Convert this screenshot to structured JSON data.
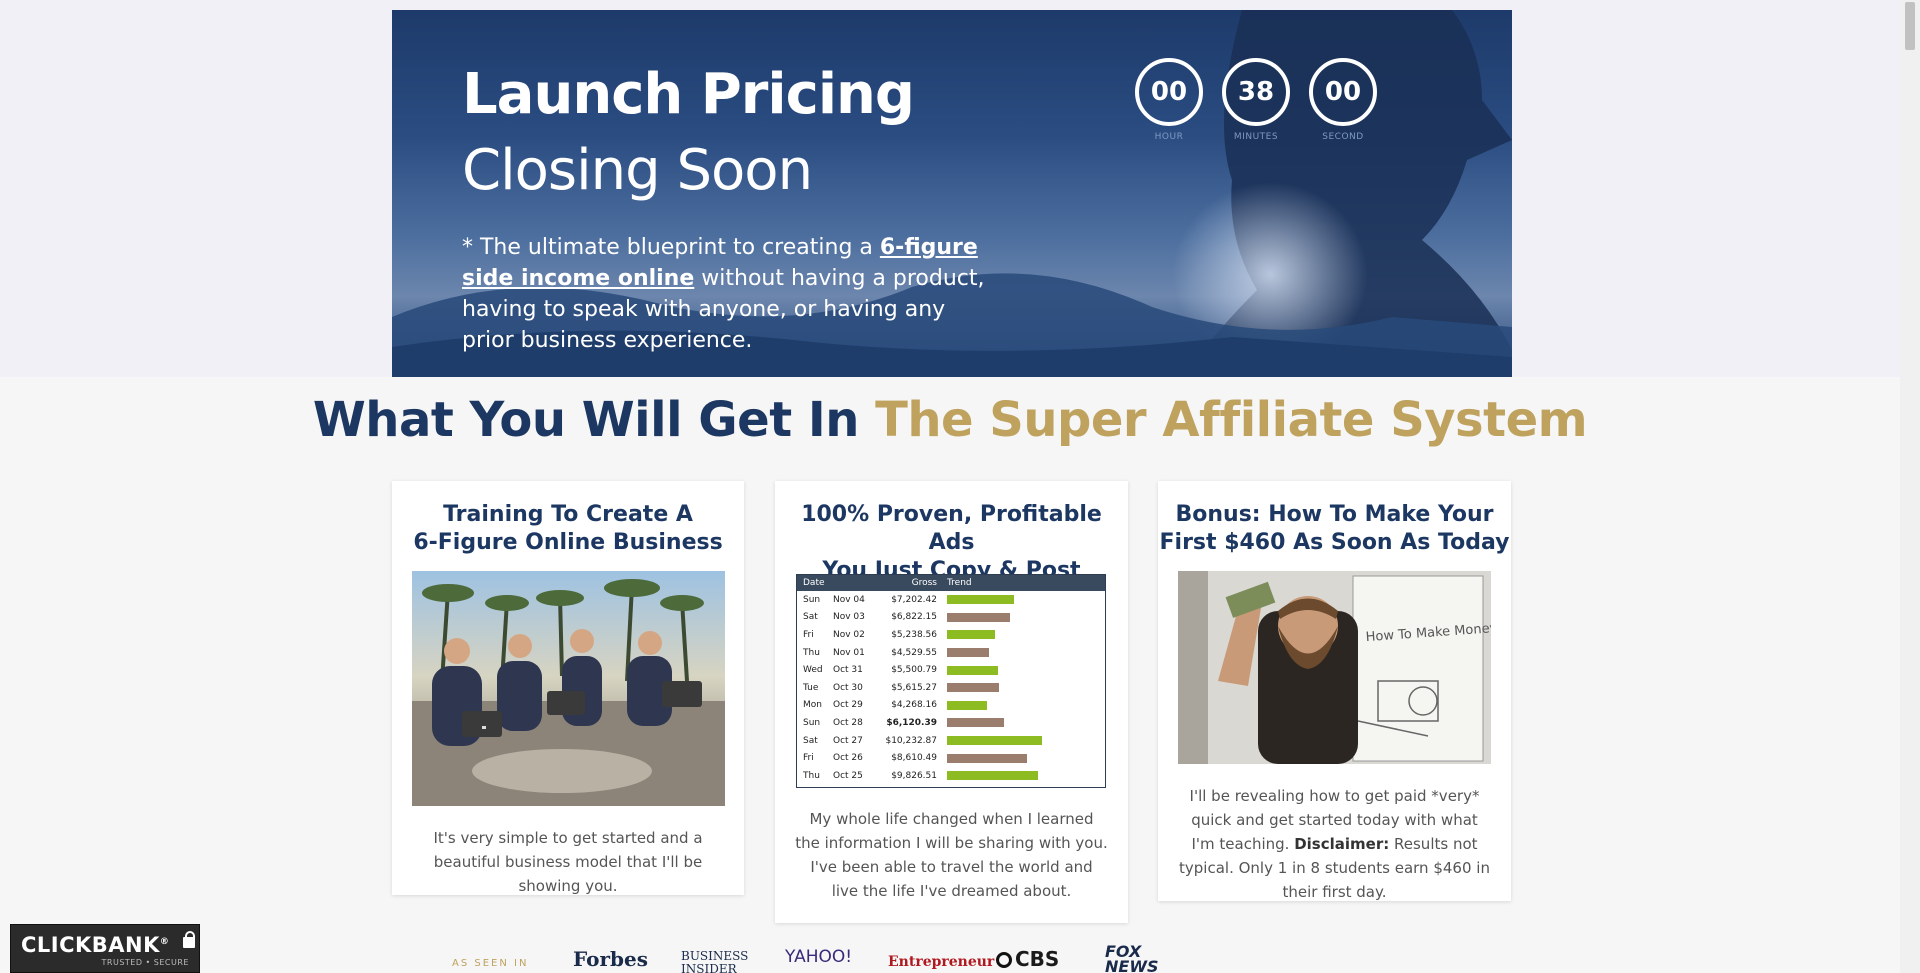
{
  "hero": {
    "title_line1": "Launch Pricing",
    "title_line2": "Closing Soon",
    "lead_prefix": "* The ultimate blueprint to creating a ",
    "lead_link": "6-figure side income online",
    "lead_suffix": " without having a product, having to speak with anyone, or having any prior business experience."
  },
  "countdown": {
    "hour": "00",
    "minutes": "38",
    "second": "00",
    "hour_label": "HOUR",
    "minutes_label": "MINUTES",
    "second_label": "SECOND"
  },
  "section": {
    "title_main": "What You Will Get In ",
    "title_accent": "The Super Affiliate System"
  },
  "cards": [
    {
      "title": "Training To Create A\n6-Figure Online Business",
      "text": "It's very simple to get started and a beautiful business model that I'll be showing you."
    },
    {
      "title": "100% Proven, Profitable Ads\nYou Just Copy & Post",
      "text": "My whole life changed when I learned the information I will be sharing with you. I've been able to travel the world and live the life I've dreamed about."
    },
    {
      "title": "Bonus: How To Make Your\nFirst $460 As Soon As Today",
      "text_main": "I'll be revealing how to get paid *very* quick and get started today with what I'm teaching.",
      "disclaimer_label": "Disclaimer:",
      "disclaimer_text": " Results not typical. Only 1 in 8 students earn $460 in their first day.",
      "whiteboard": "How To Make Money Online"
    }
  ],
  "sales_table": {
    "headers": [
      "Date",
      "",
      "Gross",
      "Trend"
    ],
    "rows": [
      {
        "day": "Sun",
        "date": "Nov 04",
        "gross": "$7,202.42",
        "trend": 0.7,
        "color": "#8dbb22"
      },
      {
        "day": "Sat",
        "date": "Nov 03",
        "gross": "$6,822.15",
        "trend": 0.66,
        "color": "#9a7d6d"
      },
      {
        "day": "Fri",
        "date": "Nov 02",
        "gross": "$5,238.56",
        "trend": 0.51,
        "color": "#8dbb22"
      },
      {
        "day": "Thu",
        "date": "Nov 01",
        "gross": "$4,529.55",
        "trend": 0.44,
        "color": "#9a7d6d"
      },
      {
        "day": "Wed",
        "date": "Oct 31",
        "gross": "$5,500.79",
        "trend": 0.54,
        "color": "#8dbb22"
      },
      {
        "day": "Tue",
        "date": "Oct 30",
        "gross": "$5,615.27",
        "trend": 0.55,
        "color": "#9a7d6d"
      },
      {
        "day": "Mon",
        "date": "Oct 29",
        "gross": "$4,268.16",
        "trend": 0.42,
        "color": "#8dbb22"
      },
      {
        "day": "Sun",
        "date": "Oct 28",
        "gross": "$6,120.39",
        "trend": 0.6,
        "color": "#9a7d6d",
        "bold": true
      },
      {
        "day": "Sat",
        "date": "Oct 27",
        "gross": "$10,232.87",
        "trend": 1.0,
        "color": "#8dbb22"
      },
      {
        "day": "Fri",
        "date": "Oct 26",
        "gross": "$8,610.49",
        "trend": 0.84,
        "color": "#9a7d6d"
      },
      {
        "day": "Thu",
        "date": "Oct 25",
        "gross": "$9,826.51",
        "trend": 0.96,
        "color": "#8dbb22"
      }
    ]
  },
  "footer": {
    "clickbank": "CLICKBANK",
    "clickbank_registered": "®",
    "clickbank_sub": "TRUSTED • SECURE",
    "as_seen_in": "AS SEEN IN",
    "logos": [
      "Forbes",
      "Business Insider",
      "YAHOO!",
      "Entrepreneur",
      "CBS",
      "FOX NEWS"
    ]
  },
  "colors": {
    "navy": "#1c3762",
    "gold": "#bea25e",
    "bar_green": "#8dbb22",
    "bar_brown": "#9a7d6d"
  }
}
